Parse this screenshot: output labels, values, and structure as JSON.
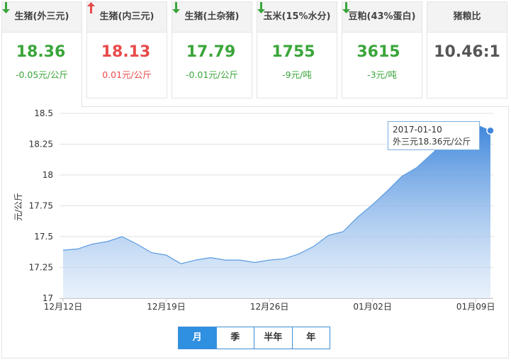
{
  "cards": [
    {
      "title": "生猪(外三元)",
      "price": "18.36",
      "direction": "down",
      "change": "-0.05元/公斤",
      "active": true
    },
    {
      "title": "生猪(内三元)",
      "price": "18.13",
      "direction": "up",
      "change": "0.01元/公斤",
      "active": false
    },
    {
      "title": "生猪(土杂猪)",
      "price": "17.79",
      "direction": "down",
      "change": "-0.01元/公斤",
      "active": false
    },
    {
      "title": "玉米(15%水分)",
      "price": "1755",
      "direction": "down",
      "change": "-9元/吨",
      "active": false
    },
    {
      "title": "豆粕(43%蛋白)",
      "price": "3615",
      "direction": "down",
      "change": "-3元/吨",
      "active": false
    },
    {
      "title": "猪粮比",
      "price": "10.46:1",
      "direction": "none",
      "change": "",
      "active": false
    }
  ],
  "colors": {
    "down": "#3aa53a",
    "up": "#e84a4a",
    "accent": "#2f8fe0",
    "line": "#5b9be0"
  },
  "tooltip": {
    "date": "2017-01-10",
    "text": "外三元18.36元/公斤"
  },
  "range_buttons": [
    {
      "label": "月",
      "active": true
    },
    {
      "label": "季",
      "active": false
    },
    {
      "label": "半年",
      "active": false
    },
    {
      "label": "年",
      "active": false
    }
  ],
  "chart_data": {
    "type": "area",
    "ylabel": "元/公斤",
    "ylim": [
      17,
      18.5
    ],
    "yticks": [
      17,
      17.25,
      17.5,
      17.75,
      18,
      18.25,
      18.5
    ],
    "xticks": [
      {
        "label": "12月12日",
        "index": 0
      },
      {
        "label": "12月19日",
        "index": 7
      },
      {
        "label": "12月26日",
        "index": 14
      },
      {
        "label": "01月02日",
        "index": 21
      },
      {
        "label": "01月09日",
        "index": 28
      }
    ],
    "x": [
      "2016-12-12",
      "2016-12-13",
      "2016-12-14",
      "2016-12-15",
      "2016-12-16",
      "2016-12-17",
      "2016-12-18",
      "2016-12-19",
      "2016-12-20",
      "2016-12-21",
      "2016-12-22",
      "2016-12-23",
      "2016-12-24",
      "2016-12-25",
      "2016-12-26",
      "2016-12-27",
      "2016-12-28",
      "2016-12-29",
      "2016-12-30",
      "2016-12-31",
      "2017-01-01",
      "2017-01-02",
      "2017-01-03",
      "2017-01-04",
      "2017-01-05",
      "2017-01-06",
      "2017-01-07",
      "2017-01-08",
      "2017-01-09",
      "2017-01-10"
    ],
    "series": [
      {
        "name": "外三元",
        "values": [
          17.39,
          17.4,
          17.44,
          17.46,
          17.5,
          17.44,
          17.37,
          17.35,
          17.28,
          17.31,
          17.33,
          17.31,
          17.31,
          17.29,
          17.31,
          17.32,
          17.36,
          17.42,
          17.51,
          17.54,
          17.66,
          17.76,
          17.87,
          17.99,
          18.06,
          18.17,
          18.28,
          18.36,
          18.41,
          18.36
        ]
      }
    ],
    "highlight_index": 29,
    "grid": true
  }
}
